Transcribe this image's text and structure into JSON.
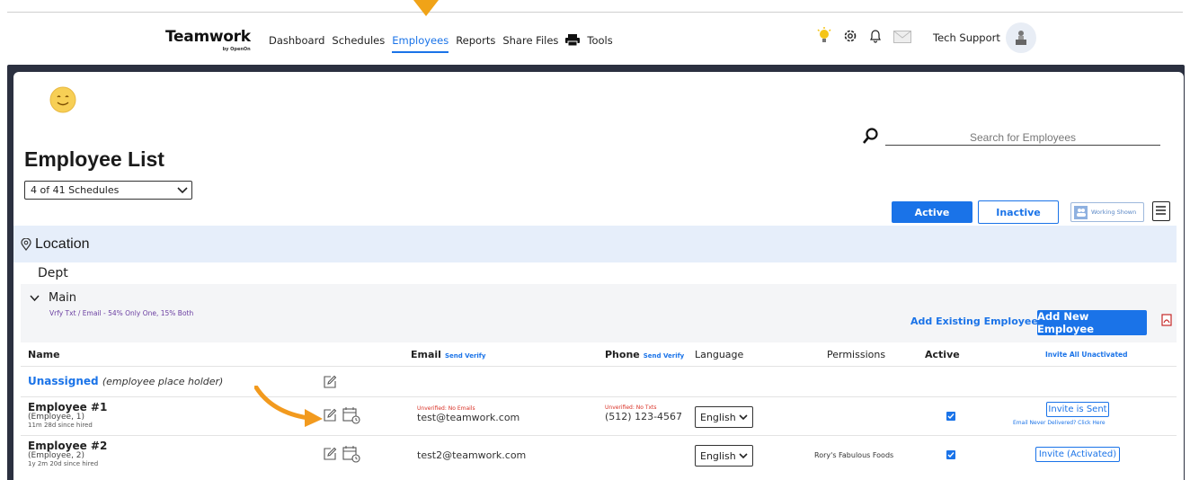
{
  "nav": {
    "brand": "Teamwork",
    "brand_sub": "by OpenOn",
    "items": [
      {
        "label": "Dashboard",
        "active": false
      },
      {
        "label": "Schedules",
        "active": false
      },
      {
        "label": "Employees",
        "active": true
      },
      {
        "label": "Reports",
        "active": false
      },
      {
        "label": "Share Files",
        "active": false
      },
      {
        "label": "Tools",
        "active": false
      }
    ],
    "user": "Tech Support"
  },
  "search": {
    "placeholder": "Search for Employees"
  },
  "page": {
    "title": "Employee List",
    "schedule_select": "4 of 41 Schedules"
  },
  "filters": {
    "active": "Active",
    "inactive": "Inactive",
    "working": "Working Shown"
  },
  "location": {
    "label": "Location"
  },
  "dept": {
    "label": "Dept"
  },
  "section": {
    "name": "Main",
    "stats": "Vrfy Txt / Email - 54% Only One, 15% Both",
    "add_existing": "Add Existing Employees",
    "add_new": "Add New Employee"
  },
  "table": {
    "headers": {
      "name": "Name",
      "email": "Email",
      "email_verify": "Send Verify",
      "phone": "Phone",
      "phone_verify": "Send Verify",
      "language": "Language",
      "permissions": "Permissions",
      "active": "Active",
      "invite_all": "Invite All Unactivated"
    },
    "unassigned": {
      "name": "Unassigned",
      "note": "(employee place holder)"
    },
    "rows": [
      {
        "name": "Employee #1",
        "sub": "(Employee, 1)",
        "hired": "11m 28d since hired",
        "email_status": "Unverified: No Emails",
        "email": "test@teamwork.com",
        "phone_status": "Unverified: No Txts",
        "phone": "(512) 123-4567",
        "language": "English",
        "permissions": "",
        "invite": "Invite is Sent",
        "invite_note": "Email Never Delivered? Click Here"
      },
      {
        "name": "Employee #2",
        "sub": "(Employee, 2)",
        "hired": "1y 2m 20d since hired",
        "email_status": "",
        "email": "test2@teamwork.com",
        "phone_status": "",
        "phone": "",
        "language": "English",
        "permissions": "Rory's Fabulous Foods",
        "invite": "Invite (Activated)",
        "invite_note": ""
      }
    ]
  },
  "colors": {
    "accent": "#1a73e8",
    "pointer": "#f0a318",
    "location_bar": "#e6eefa",
    "frame": "#2b3040"
  }
}
